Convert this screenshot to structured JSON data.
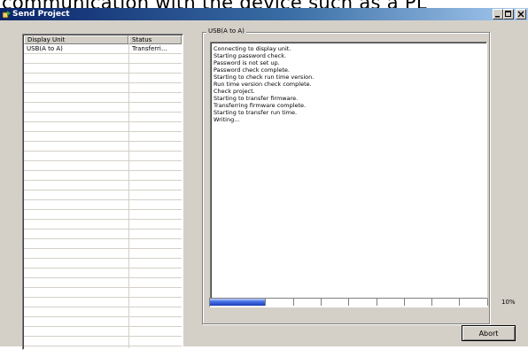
{
  "caption": "communication with the device such as a PL",
  "window": {
    "title": "Send Project",
    "controls": {
      "minimize_icon": "minimize-icon",
      "maximize_icon": "maximize-icon",
      "close_icon": "close-icon"
    }
  },
  "device_list": {
    "columns": [
      "Display Unit",
      "Status"
    ],
    "rows": [
      {
        "display_unit": "USB(A to A)",
        "status": "Transferri..."
      }
    ]
  },
  "log_panel": {
    "group_label": "USB(A to A)",
    "lines": [
      "Connecting to display unit.",
      "Starting password check.",
      "Password is not set up.",
      "Password check complete.",
      "Starting to check run time version.",
      "Run time version check complete.",
      "Check project.",
      "Starting to transfer firmware.",
      "Transferring firmware complete.",
      "Starting to transfer run time.",
      "Writing..."
    ]
  },
  "progress": {
    "percent": 10,
    "label": "10%",
    "segments_total": 10,
    "segments_filled": 2,
    "fill_color": "#2a4fd0"
  },
  "buttons": {
    "abort_label": "Abort"
  },
  "colors": {
    "titlebar_start": "#0a246a",
    "titlebar_end": "#a6caf0",
    "face": "#d4d0c8"
  }
}
